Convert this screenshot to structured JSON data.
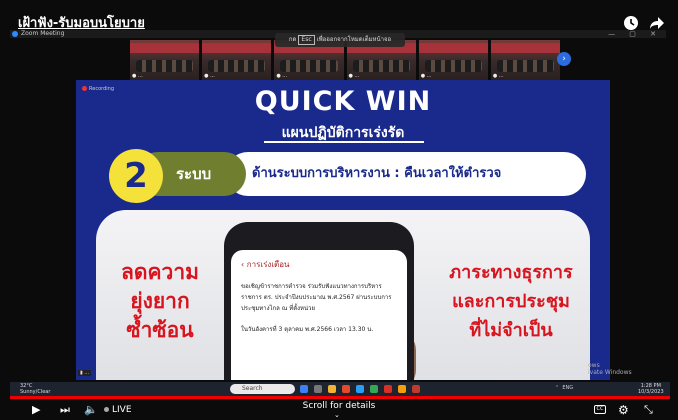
{
  "video": {
    "title": "เฝ้าฟัง-รับมอบนโยบาย",
    "zoom_app": "Zoom Meeting",
    "recording_label": "Recording"
  },
  "esc_toast": {
    "prefix": "กด",
    "key": "Esc",
    "suffix": "เพื่อออกจากโหมดเต็มหน้าจอ"
  },
  "slide": {
    "title": "QUICK WIN",
    "subtitle": "แผนปฏิบัติการเร่งรัด",
    "number": "2",
    "section": "ระบบ",
    "topic": "ด้านระบบการบริหารงาน : คืนเวลาให้ตำรวจ",
    "left_lines": [
      "ลดความ",
      "ยุ่งยาก",
      "ซ้ำซ้อน"
    ],
    "right_lines": [
      "ภาระทางธุรการ",
      "และการประชุม",
      "ที่ไม่จำเป็น"
    ],
    "phone": {
      "back_label": "การเร่งเตือน",
      "message": "ขอเชิญข้าราชการตำรวจ ร่วมรับฟังแนวทางการบริหารราชการ ตร. ประจำปีงบประมาณ พ.ศ.2567 ผ่านระบบการประชุมทางไกล ณ ที่ตั้งหน่วย",
      "schedule": "ในวันอังคารที่ 3 ตุลาคม พ.ศ.2566 เวลา 13.30 น."
    }
  },
  "windows": {
    "weather_temp": "32°C",
    "weather_desc": "Sunny/Clear",
    "search": "Search",
    "lang": "ENG",
    "clock_time": "1:28 PM",
    "clock_date": "10/3/2023",
    "watermark_line1": "ows",
    "watermark_line2": "ivate Windows"
  },
  "player": {
    "live_label": "LIVE",
    "scroll_hint": "Scroll for details"
  }
}
